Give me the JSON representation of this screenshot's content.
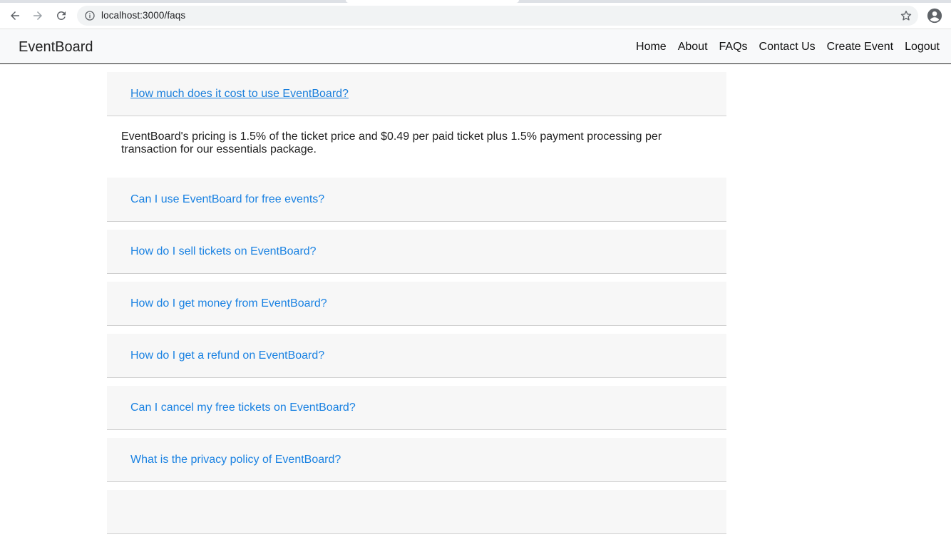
{
  "browser": {
    "url": "localhost:3000/faqs",
    "icons": {
      "back": "arrow-left-icon",
      "forward": "arrow-right-icon",
      "reload": "reload-icon",
      "info": "info-icon",
      "bookmark": "star-icon",
      "profile": "account-circle-icon"
    }
  },
  "navbar": {
    "brand": "EventBoard",
    "links": [
      "Home",
      "About",
      "FAQs",
      "Contact Us",
      "Create Event",
      "Logout"
    ]
  },
  "faqs": [
    {
      "question": "How much does it cost to use EventBoard?",
      "answer": "EventBoard's pricing is 1.5% of the ticket price and $0.49 per paid ticket plus 1.5% payment processing per transaction for our essentials package.",
      "expanded": true
    },
    {
      "question": "Can I use EventBoard for free events?",
      "expanded": false
    },
    {
      "question": "How do I sell tickets on EventBoard?",
      "expanded": false
    },
    {
      "question": "How do I get money from EventBoard?",
      "expanded": false
    },
    {
      "question": "How do I get a refund on EventBoard?",
      "expanded": false
    },
    {
      "question": "Can I cancel my free tickets on EventBoard?",
      "expanded": false
    },
    {
      "question": "What is the privacy policy of EventBoard?",
      "expanded": false
    }
  ],
  "colors": {
    "link": "#1a82e2",
    "panel": "#f7f7f7",
    "navbar": "#f8f9fa"
  }
}
